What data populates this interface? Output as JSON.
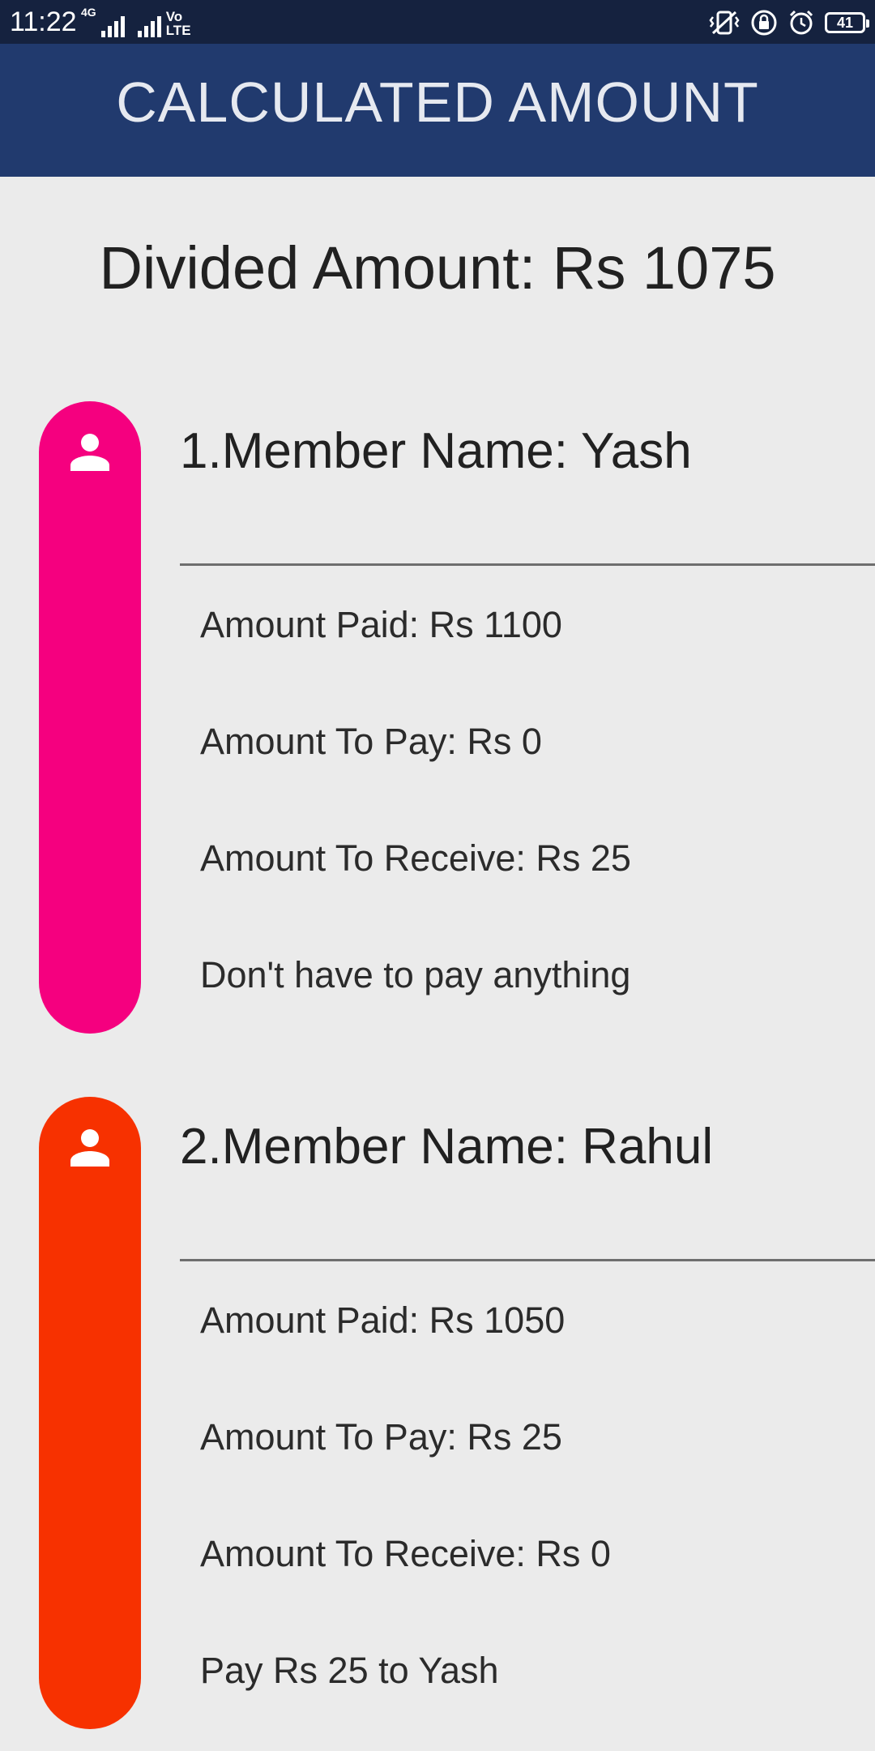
{
  "status_bar": {
    "time": "11:22",
    "network_label": "4G",
    "volte_line1": "Vo",
    "volte_line2": "LTE",
    "battery": "41",
    "icons": [
      "signal-icon",
      "signal-icon",
      "vibrate-icon",
      "lock-rotation-icon",
      "alarm-icon",
      "battery-icon"
    ]
  },
  "header": {
    "title": "CALCULATED AMOUNT"
  },
  "summary": {
    "divided_amount": "Divided Amount: Rs 1075"
  },
  "members": [
    {
      "color": "#f5007f",
      "icon": "person-icon",
      "name": "1.Member Name: Yash",
      "amount_paid": "Amount Paid: Rs 1100",
      "amount_to_pay": "Amount To Pay: Rs 0",
      "amount_to_receive": "Amount To Receive: Rs 25",
      "status": "Don't have to pay anything"
    },
    {
      "color": "#f73100",
      "icon": "person-icon",
      "name": "2.Member Name: Rahul",
      "amount_paid": "Amount Paid: Rs 1050",
      "amount_to_pay": "Amount To Pay: Rs 25",
      "amount_to_receive": "Amount To Receive: Rs 0",
      "status": "Pay Rs 25 to Yash"
    }
  ]
}
